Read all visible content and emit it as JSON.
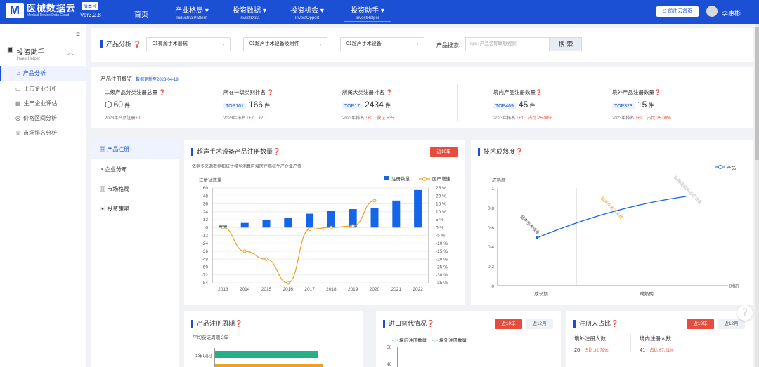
{
  "header": {
    "brand": "医械数据云",
    "brand_en": "Medical Device Data Cloud",
    "version_badge": "版本号",
    "version": "Ver3.2.8",
    "nav": [
      {
        "label": "首页",
        "sub": ""
      },
      {
        "label": "产业格局 ▾",
        "sub": "IndustrialPattern"
      },
      {
        "label": "投资数据 ▾",
        "sub": "InvestData"
      },
      {
        "label": "投资机会 ▾",
        "sub": "InvestOpport"
      },
      {
        "label": "投资助手 ▾",
        "sub": "InvestHelper"
      }
    ],
    "cloud_button": "前往云首页",
    "user": "李惠彬"
  },
  "sidebar": {
    "collapse": "≡",
    "group": "投资助手",
    "group_en": "InvestHelper",
    "items": [
      {
        "label": "产品分析"
      },
      {
        "label": "上市企业分析"
      },
      {
        "label": "生产企业评估"
      },
      {
        "label": "价格区间分析"
      },
      {
        "label": "市场排名分析"
      }
    ]
  },
  "filter": {
    "title": "产品分析",
    "selects": [
      "01有源手术器械",
      "01超声手术设备及附件",
      "01超声手术设备"
    ],
    "search_label": "产品搜索:",
    "search_placeholder": "tips: 产品名称联想搜索",
    "search_button": "搜 索"
  },
  "overview": {
    "title": "产品注册概览",
    "updated": "数据更新至2023-04-19",
    "stats": [
      {
        "label": "二级产品分类注册总量",
        "tag": "",
        "value": "60",
        "unit": "件",
        "note": "2023年产品注册",
        "delta": "+0",
        "delta2": ""
      },
      {
        "label": "所在一级类别排名",
        "tag": "TOP161",
        "value": "166",
        "unit": "件",
        "note": "2023年排名",
        "delta": "↑+7",
        "delta2": "+2"
      },
      {
        "label": "所属大类注册排名",
        "tag": "TOP17",
        "value": "2434",
        "unit": "件",
        "note": "2023年排名",
        "delta": "↑+0",
        "delta2": "获证 +35"
      },
      {
        "label": "境内产品注册数量",
        "tag": "TOP469",
        "value": "45",
        "unit": "件",
        "note": "2023年排名",
        "delta": "↑+1",
        "delta2": "占比:75.00%"
      },
      {
        "label": "境外产品注册数量",
        "tag": "TOP323",
        "value": "15",
        "unit": "件",
        "note": "2023年排名",
        "delta": "↑+2",
        "delta2": "占比:25.00%"
      }
    ]
  },
  "tabs": [
    {
      "label": "产品注册"
    },
    {
      "label": "企业分布"
    },
    {
      "label": "市场格局"
    },
    {
      "label": "投资策略"
    }
  ],
  "reg_chart": {
    "title": "超声手术设备产品注册数量",
    "badge": "近10年",
    "desc": "依据多来源数据和统计模型测算区域医疗器械生产企业产值",
    "legend_bar": "注册数量",
    "legend_line": "国产增速",
    "y_title": "注册证数量"
  },
  "maturity": {
    "title": "技术成熟度",
    "legend": "产品",
    "y_title": "成熟度",
    "x_title": "时间",
    "stage1": "成长期",
    "stage2": "成熟期",
    "label_a": "高强度超声治疗设备",
    "label_b": "超声手术设备",
    "label_c": "超声手术刀系统"
  },
  "period": {
    "title": "产品注册周期",
    "avg": "平均获证周期 2年",
    "row1": "1年以内"
  },
  "import": {
    "title": "进口替代情况",
    "badge1": "近10年",
    "badge2": "近12月",
    "legend1": "境内注册数量",
    "legend2": "境外注册数量",
    "ytick1": "50",
    "ytick2": "40"
  },
  "registrant": {
    "title": "注册人占比",
    "badge1": "近10年",
    "badge2": "近12月",
    "out_label": "境外注册人数",
    "out_value": "20",
    "out_pct": "占比:32.79%",
    "in_label": "境内注册人数",
    "in_value": "41",
    "in_pct": "占比:67.21%"
  },
  "colors": {
    "primary": "#1b4fd4",
    "bar": "#1565e8",
    "line": "#f0a020",
    "red": "#e74c3c"
  },
  "chart_data": {
    "type": "bar",
    "categories": [
      "2013",
      "2014",
      "2015",
      "2016",
      "2017",
      "2018",
      "2019",
      "2020",
      "2021",
      "2022"
    ],
    "series": [
      {
        "name": "注册数量",
        "type": "bar",
        "values": [
          3,
          7,
          11,
          15,
          21,
          25,
          28,
          30,
          41,
          57
        ]
      },
      {
        "name": "国产增速",
        "type": "line",
        "values": [
          0,
          -15,
          -20,
          -35,
          -1,
          0,
          1,
          17,
          null,
          null
        ],
        "unit": "%"
      }
    ],
    "ylim": [
      -84,
      60
    ],
    "y2lim": [
      -35,
      25
    ],
    "yticks": [
      "60",
      "48",
      "36",
      "24",
      "12",
      "0",
      "-12",
      "-24",
      "-36",
      "-48",
      "-60",
      "-72",
      "-84"
    ],
    "y2ticks": [
      "25 %",
      "20 %",
      "15 %",
      "10 %",
      "5 %",
      "0 %",
      "-5 %",
      "-10 %",
      "-15 %",
      "-20 %",
      "-25 %",
      "-30 %",
      "-35 %"
    ],
    "ylabel": "注册证数量",
    "grid": true,
    "legend": "top-right"
  },
  "maturity_chart": {
    "type": "line",
    "series": [
      {
        "name": "产品"
      }
    ],
    "yticks": [
      "1",
      "0.8",
      "0.6",
      "0.4",
      "0.2",
      "0"
    ]
  }
}
